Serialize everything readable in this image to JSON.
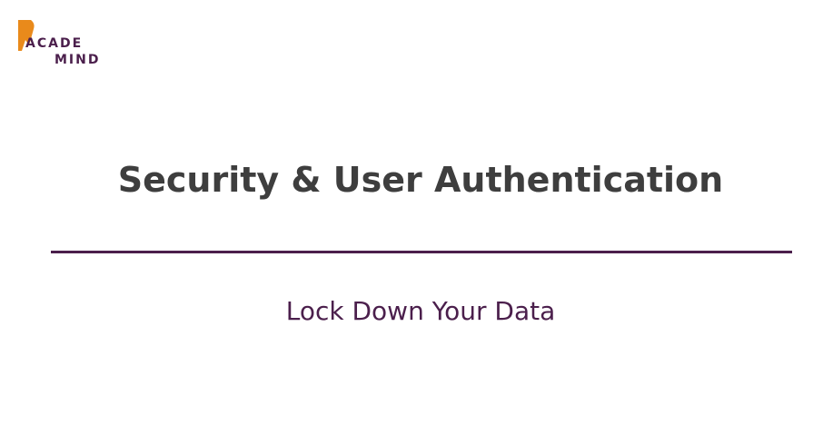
{
  "logo": {
    "icon": "academind-logo-icon",
    "line1": "ACADE",
    "line2": "MIND",
    "colors": {
      "mark": "#e98a1b",
      "text": "#4b1f4c"
    }
  },
  "slide": {
    "title": "Security & User Authentication",
    "subtitle": "Lock Down Your Data",
    "colors": {
      "title": "#3e3e3e",
      "accent": "#4b1f4c",
      "background": "#ffffff"
    }
  }
}
